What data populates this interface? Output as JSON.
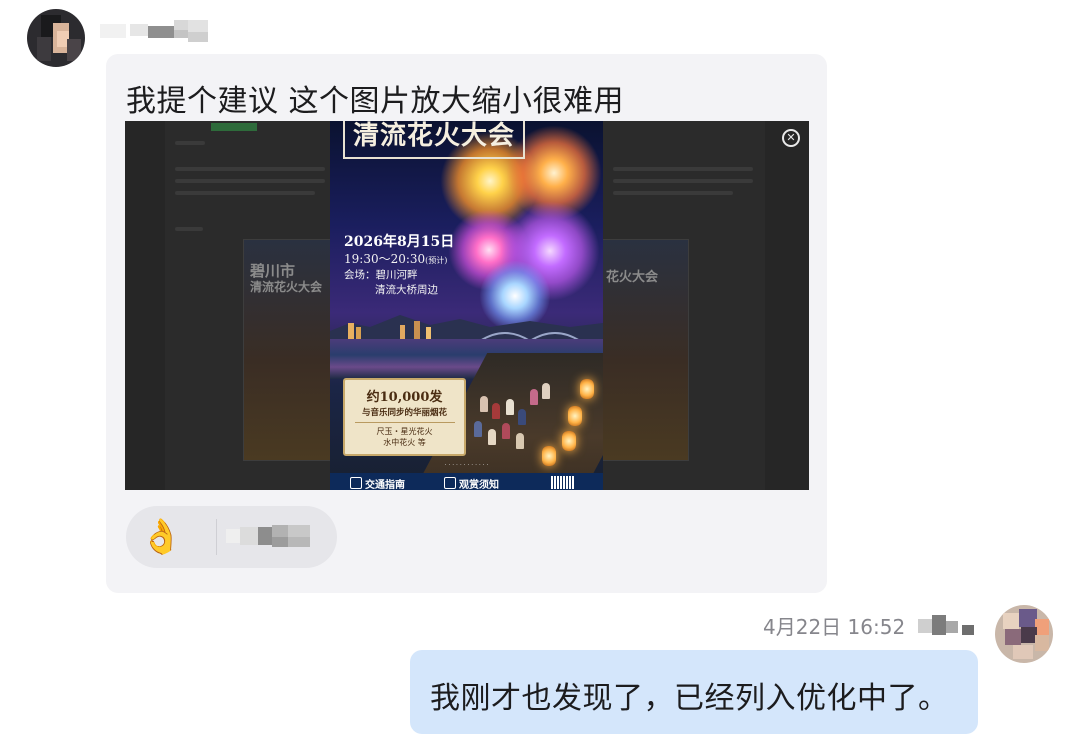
{
  "messages": {
    "incoming": {
      "text": "我提个建议 这个图片放大缩小很难用",
      "attachment": {
        "poster": {
          "title": "清流花火大会",
          "date": "2026年8月15日",
          "time": "19:30～20:30",
          "time_note": "(预计)",
          "venue_label": "会场：碧川河畔",
          "venue_detail": "清流大桥周边",
          "highlight_count": "约10,000发",
          "highlight_desc": "与音乐同步的华丽烟花",
          "highlight_items_1": "尺玉・星光花火",
          "highlight_items_2": "水中花火 等",
          "footer_item_1": "交通指南",
          "footer_item_2": "观赏须知"
        },
        "background_card_left": {
          "line1": "碧川市",
          "line2": "清流花火大会"
        },
        "background_card_right": {
          "line1": "花火大会"
        }
      },
      "reaction": {
        "emoji": "👌"
      }
    },
    "outgoing": {
      "timestamp": "4月22日 16:52",
      "text": "我刚才也发现了，已经列入优化中了。"
    }
  },
  "colors": {
    "incoming_bubble": "#f3f3f6",
    "outgoing_bubble": "#d4e6fb",
    "reaction_chip": "#e6e6ea",
    "timestamp": "#86868c"
  }
}
